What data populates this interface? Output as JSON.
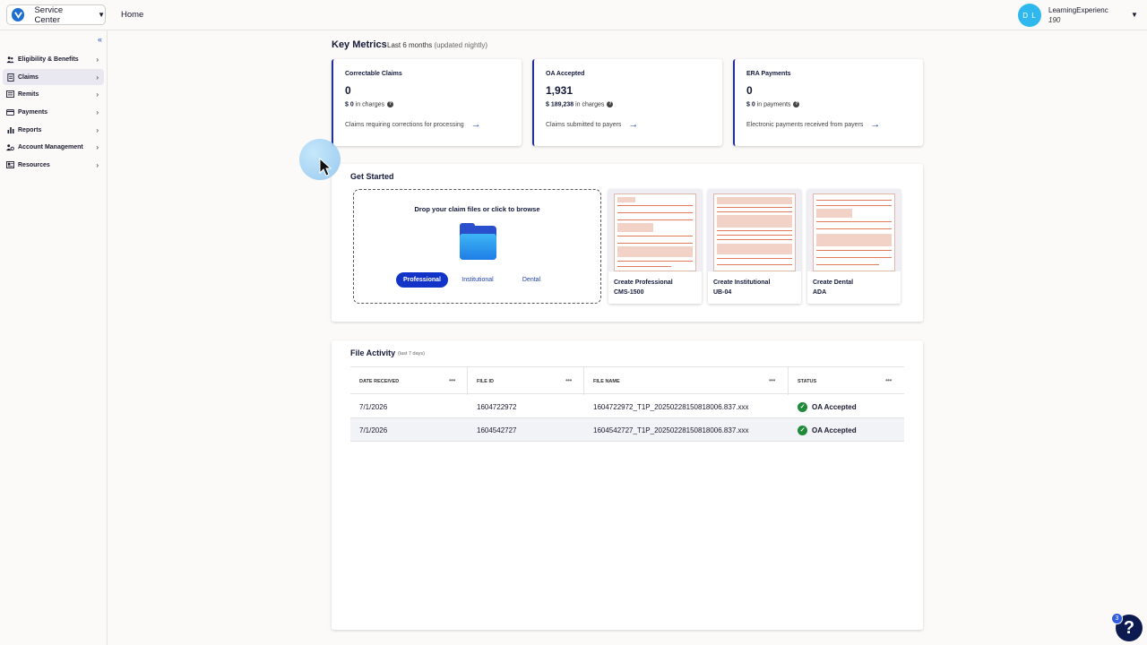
{
  "header": {
    "app_name": "Service Center",
    "home_label": "Home",
    "user_initials": "D L",
    "user_name": "LearningExperienc",
    "user_sub": "190"
  },
  "sidebar": {
    "collapse_glyph": "«",
    "items": [
      {
        "label": "Eligibility & Benefits",
        "icon": "people-icon",
        "active": false
      },
      {
        "label": "Claims",
        "icon": "document-icon",
        "active": true
      },
      {
        "label": "Remits",
        "icon": "list-icon",
        "active": false
      },
      {
        "label": "Payments",
        "icon": "card-icon",
        "active": false
      },
      {
        "label": "Reports",
        "icon": "bar-chart-icon",
        "active": false
      },
      {
        "label": "Account Management",
        "icon": "users-gear-icon",
        "active": false
      },
      {
        "label": "Resources",
        "icon": "book-icon",
        "active": false
      }
    ]
  },
  "key_metrics": {
    "title": "Key Metrics",
    "period": "Last 6 months",
    "period_note": "(updated nightly)",
    "cards": [
      {
        "title": "Correctable Claims",
        "value": "0",
        "amount": "$ 0",
        "amount_suffix": "in charges",
        "description": "Claims requiring corrections for processing"
      },
      {
        "title": "OA Accepted",
        "value": "1,931",
        "amount": "$ 189,238",
        "amount_suffix": "in charges",
        "description": "Claims submitted to payers"
      },
      {
        "title": "ERA Payments",
        "value": "0",
        "amount": "$ 0",
        "amount_suffix": "in payments",
        "description": "Electronic payments received from payers"
      }
    ]
  },
  "get_started": {
    "title": "Get Started",
    "dropzone_text": "Drop your claim files or click to browse",
    "claim_types": [
      "Professional",
      "Institutional",
      "Dental"
    ],
    "selected_type": "Professional",
    "forms": [
      {
        "line1": "Create Professional",
        "line2": "CMS-1500"
      },
      {
        "line1": "Create Institutional",
        "line2": "UB-04"
      },
      {
        "line1": "Create Dental",
        "line2": "ADA"
      }
    ]
  },
  "file_activity": {
    "title": "File Activity",
    "subtitle": "(last 7 days)",
    "columns": [
      "DATE RECEIVED",
      "FILE ID",
      "FILE NAME",
      "STATUS"
    ],
    "rows": [
      {
        "date": "7/1/2026",
        "file_id": "1604722972",
        "file_name": "1604722972_T1P_20250228150818006.837.xxx",
        "status": "OA Accepted"
      },
      {
        "date": "7/1/2026",
        "file_id": "1604542727",
        "file_name": "1604542727_T1P_20250228150818006.837.xxx",
        "status": "OA Accepted"
      }
    ]
  },
  "help": {
    "glyph": "?",
    "badge_count": "3"
  },
  "colors": {
    "accent": "#1233c7",
    "status_success": "#1f8a3a",
    "avatar": "#2fb8ee"
  }
}
